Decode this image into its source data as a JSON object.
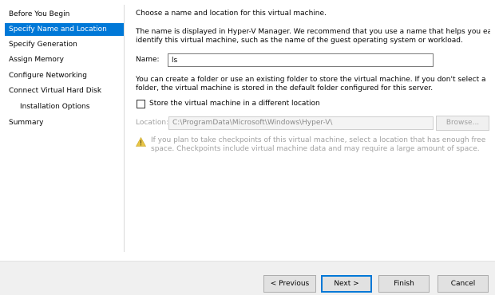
{
  "sidebar": {
    "items": [
      {
        "label": "Before You Begin"
      },
      {
        "label": "Specify Name and Location"
      },
      {
        "label": "Specify Generation"
      },
      {
        "label": "Assign Memory"
      },
      {
        "label": "Configure Networking"
      },
      {
        "label": "Connect Virtual Hard Disk"
      },
      {
        "label": "Installation Options"
      },
      {
        "label": "Summary"
      }
    ],
    "active_index": 1
  },
  "main": {
    "heading": "Choose a name and location for this virtual machine.",
    "description_line1": "The name is displayed in Hyper-V Manager. We recommend that you use a name that helps you easily",
    "description_line2": "identify this virtual machine, such as the name of the guest operating system or workload.",
    "name_label": "Name:",
    "name_value": "ls",
    "folder_line1": "You can create a folder or use an existing folder to store the virtual machine. If you don't select a",
    "folder_line2": "folder, the virtual machine is stored in the default folder configured for this server.",
    "store_checkbox_label": "Store the virtual machine in a different location",
    "store_checkbox_checked": false,
    "location_label": "Location:",
    "location_value": "C:\\ProgramData\\Microsoft\\Windows\\Hyper-V\\",
    "browse_label": "Browse...",
    "warning_line1": "If you plan to take checkpoints of this virtual machine, select a location that has enough free",
    "warning_line2": "space. Checkpoints include virtual machine data and may require a large amount of space."
  },
  "footer": {
    "previous_label": "< Previous",
    "next_label": "Next >",
    "finish_label": "Finish",
    "cancel_label": "Cancel"
  },
  "colors": {
    "accent": "#0078d7",
    "warning": "#e8c547"
  }
}
